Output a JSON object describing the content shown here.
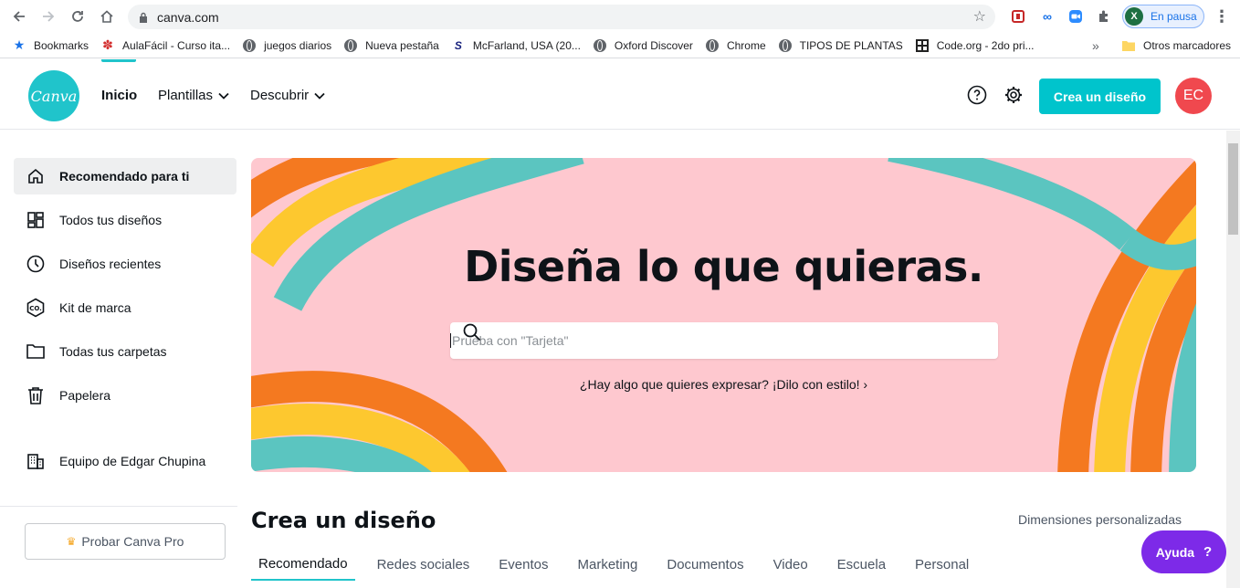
{
  "browser": {
    "url": "canva.com",
    "profile_label": "En pausa",
    "profile_icon_letter": "X",
    "bookmarks": [
      {
        "label": "Bookmarks",
        "icon": "star-icon"
      },
      {
        "label": "AulaFácil - Curso ita...",
        "icon": "aulafacil-icon"
      },
      {
        "label": "juegos diarios",
        "icon": "globe-icon"
      },
      {
        "label": "Nueva pestaña",
        "icon": "globe-icon"
      },
      {
        "label": "McFarland, USA (20...",
        "icon": "site-icon"
      },
      {
        "label": "Oxford Discover",
        "icon": "globe-icon"
      },
      {
        "label": "Chrome",
        "icon": "globe-icon"
      },
      {
        "label": "TIPOS DE PLANTAS",
        "icon": "globe-icon"
      },
      {
        "label": "Code.org - 2do pri...",
        "icon": "code-org-icon"
      }
    ],
    "more_bookmarks": "»",
    "other_bookmarks": "Otros marcadores"
  },
  "header": {
    "logo_text": "Canva",
    "nav": [
      {
        "label": "Inicio",
        "active": true
      },
      {
        "label": "Plantillas",
        "dropdown": true
      },
      {
        "label": "Descubrir",
        "dropdown": true
      }
    ],
    "create_button": "Crea un diseño",
    "avatar_initials": "EC"
  },
  "sidebar": {
    "items": [
      {
        "label": "Recomendado para ti",
        "icon": "home-icon",
        "active": true
      },
      {
        "label": "Todos tus diseños",
        "icon": "grid-icon"
      },
      {
        "label": "Diseños recientes",
        "icon": "clock-icon"
      },
      {
        "label": "Kit de marca",
        "icon": "brand-kit-icon"
      },
      {
        "label": "Todas tus carpetas",
        "icon": "folder-icon"
      },
      {
        "label": "Papelera",
        "icon": "trash-icon"
      },
      {
        "label": "Equipo de Edgar Chupina",
        "icon": "building-icon"
      }
    ],
    "pro_button": "Probar Canva Pro"
  },
  "hero": {
    "title": "Diseña lo que quieras.",
    "search_placeholder": "Prueba con \"Tarjeta\"",
    "link": "¿Hay algo que quieres expresar? ¡Dilo con estilo! ›"
  },
  "section": {
    "title": "Crea un diseño",
    "custom_dimensions": "Dimensiones personalizadas",
    "tabs": [
      "Recomendado",
      "Redes sociales",
      "Eventos",
      "Marketing",
      "Documentos",
      "Video",
      "Escuela",
      "Personal"
    ]
  },
  "help_button": {
    "label": "Ayuda",
    "icon_text": "?"
  },
  "colors": {
    "accent": "#00c4cc",
    "hero_bg": "#fec8cf",
    "help": "#7d2ae8",
    "avatar": "#f0484e"
  }
}
